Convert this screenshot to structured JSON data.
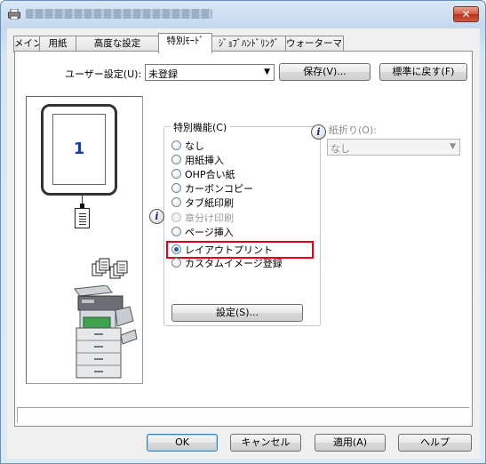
{
  "window": {
    "close_label": "✕"
  },
  "tabs": [
    {
      "label": "メイン"
    },
    {
      "label": "用紙"
    },
    {
      "label": "高度な設定"
    },
    {
      "label": "特別ﾓｰﾄﾞ",
      "active": true
    },
    {
      "label": "ｼﾞｮﾌﾞﾊﾝﾄﾞﾘﾝｸﾞ"
    },
    {
      "label": "ウォーターマーク"
    }
  ],
  "user_settings": {
    "label": "ユーザー設定(U):",
    "value": "未登録",
    "save_button": "保存(V)...",
    "reset_button": "標準に戻す(F)"
  },
  "preview": {
    "page_number": "1"
  },
  "special_function": {
    "group_label": "特別機能(C)",
    "options": [
      {
        "label": "なし",
        "checked": false,
        "enabled": true
      },
      {
        "label": "用紙挿入",
        "checked": false,
        "enabled": true
      },
      {
        "label": "OHP合い紙",
        "checked": false,
        "enabled": true
      },
      {
        "label": "カーボンコピー",
        "checked": false,
        "enabled": true
      },
      {
        "label": "タブ紙印刷",
        "checked": false,
        "enabled": true
      },
      {
        "label": "章分け印刷",
        "checked": false,
        "enabled": false
      },
      {
        "label": "ページ挿入",
        "checked": false,
        "enabled": true
      },
      {
        "label": "レイアウトプリント",
        "checked": true,
        "enabled": true
      },
      {
        "label": "カスタムイメージ登録",
        "checked": false,
        "enabled": true
      }
    ],
    "settings_button": "設定(S)..."
  },
  "fold": {
    "label": "紙折り(O):",
    "value": "なし"
  },
  "info_icon_glyph": "i",
  "buttons": {
    "ok": "OK",
    "cancel": "キャンセル",
    "apply": "適用(A)",
    "help": "ヘルプ"
  },
  "colors": {
    "highlight": "#e4001b",
    "selected_radio": "#2a5ea0",
    "page_number": "#1c3e9e"
  }
}
